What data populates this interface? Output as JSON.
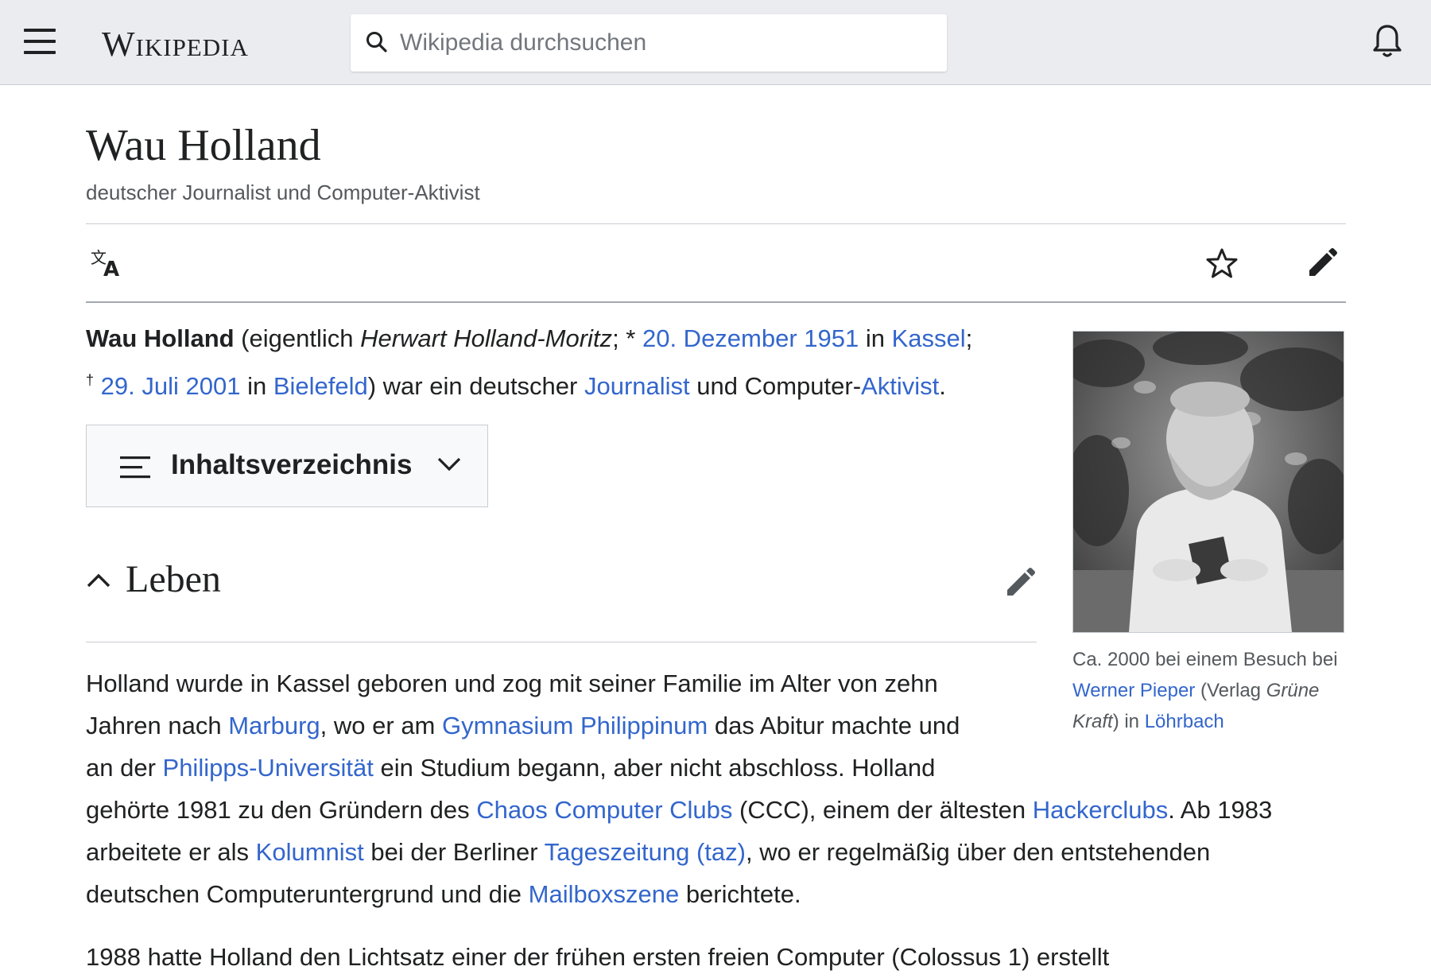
{
  "header": {
    "logo": "Wikipedia",
    "search_placeholder": "Wikipedia durchsuchen"
  },
  "article": {
    "title": "Wau Holland",
    "tagline": "deutscher Journalist und Computer-Aktivist",
    "lead": {
      "name": "Wau Holland",
      "t1": " (eigentlich ",
      "real_name": "Herwart Holland-Moritz",
      "t2": "; * ",
      "birth_date": "20. Dezember 1951",
      "t3": " in ",
      "birth_place": "Kassel",
      "t4": ";",
      "death_mark": "†",
      "t5": " ",
      "death_date": "29. Juli 2001",
      "t6": " in ",
      "death_place": "Bielefeld",
      "t7": ") war ein deutscher ",
      "journalist": "Journalist",
      "t8": " und Computer-",
      "aktivist": "Aktivist",
      "t9": "."
    },
    "toc_label": "Inhaltsverzeichnis",
    "section_title": "Leben",
    "para": {
      "l1": "Holland wurde in Kassel geboren und zog mit seiner Familie im Alter von zehn",
      "l2a": "Jahren nach ",
      "l2_link1": "Marburg",
      "l2b": ", wo er am ",
      "l2_link2": "Gymnasium Philippinum",
      "l2c": " das Abitur machte und",
      "l3a": "an der ",
      "l3_link": "Philipps-Universität",
      "l3b": " ein Studium begann, aber nicht abschloss. Holland",
      "l4a": "gehörte 1981 zu den Gründern des ",
      "l4_link1": "Chaos Computer Clubs",
      "l4b": " (CCC), einem der ältesten ",
      "l4_link2": "Hackerclubs",
      "l4c": ". Ab 1983",
      "l5a": "arbeitete er als ",
      "l5_link1": "Kolumnist",
      "l5b": " bei der Berliner ",
      "l5_link2": "Tageszeitung (taz)",
      "l5c": ", wo er regelmäßig über den entstehenden",
      "l6a": "deutschen Computeruntergrund und die ",
      "l6_link": "Mailboxszene",
      "l6b": " berichtete."
    },
    "para2_partial": "1988 hatte Holland den Lichtsatz einer der frühen ersten freien Computer (Colossus 1) erstellt"
  },
  "figure": {
    "cap1": "Ca. 2000 bei einem Besuch bei ",
    "cap_link1": "Werner Pieper",
    "cap2": " (Verlag ",
    "cap_italic": "Grüne Kraft",
    "cap3": ") in ",
    "cap_link2": "Löhrbach"
  },
  "colors": {
    "link": "#3366cc",
    "header_bg": "#eaecf0",
    "text": "#202122"
  }
}
